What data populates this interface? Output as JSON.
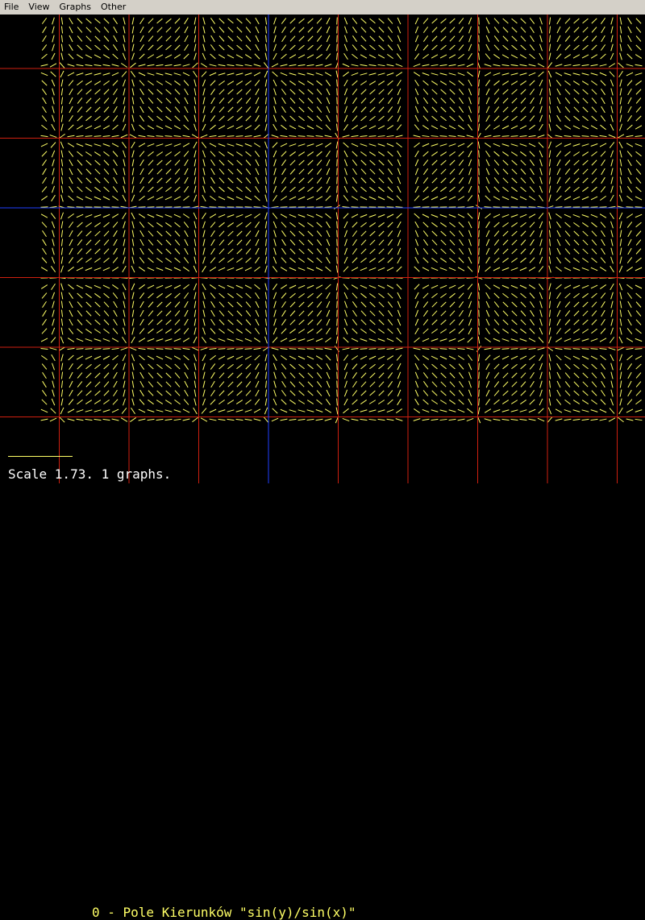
{
  "menu": {
    "items": [
      "File",
      "View",
      "Graphs",
      "Other"
    ]
  },
  "graph": {
    "index": "0",
    "title": "0 - Pole Kierunków \"sin(y)/sin(x)\"",
    "function": "sin(y)/sin(x)",
    "type": "direction-field"
  },
  "status": {
    "text": "Scale 1.73. 1 graphs."
  },
  "colors": {
    "background": "#000000",
    "grid": "#d02010",
    "axes": "#2040ff",
    "field": "#ffff66",
    "menubar": "#d4d0c8",
    "status_text": "#ffffff"
  },
  "chart_data": {
    "type": "direction-field",
    "expression": "sin(y)/sin(x)",
    "scale": 1.73,
    "graphs": 1,
    "grid": true
  }
}
